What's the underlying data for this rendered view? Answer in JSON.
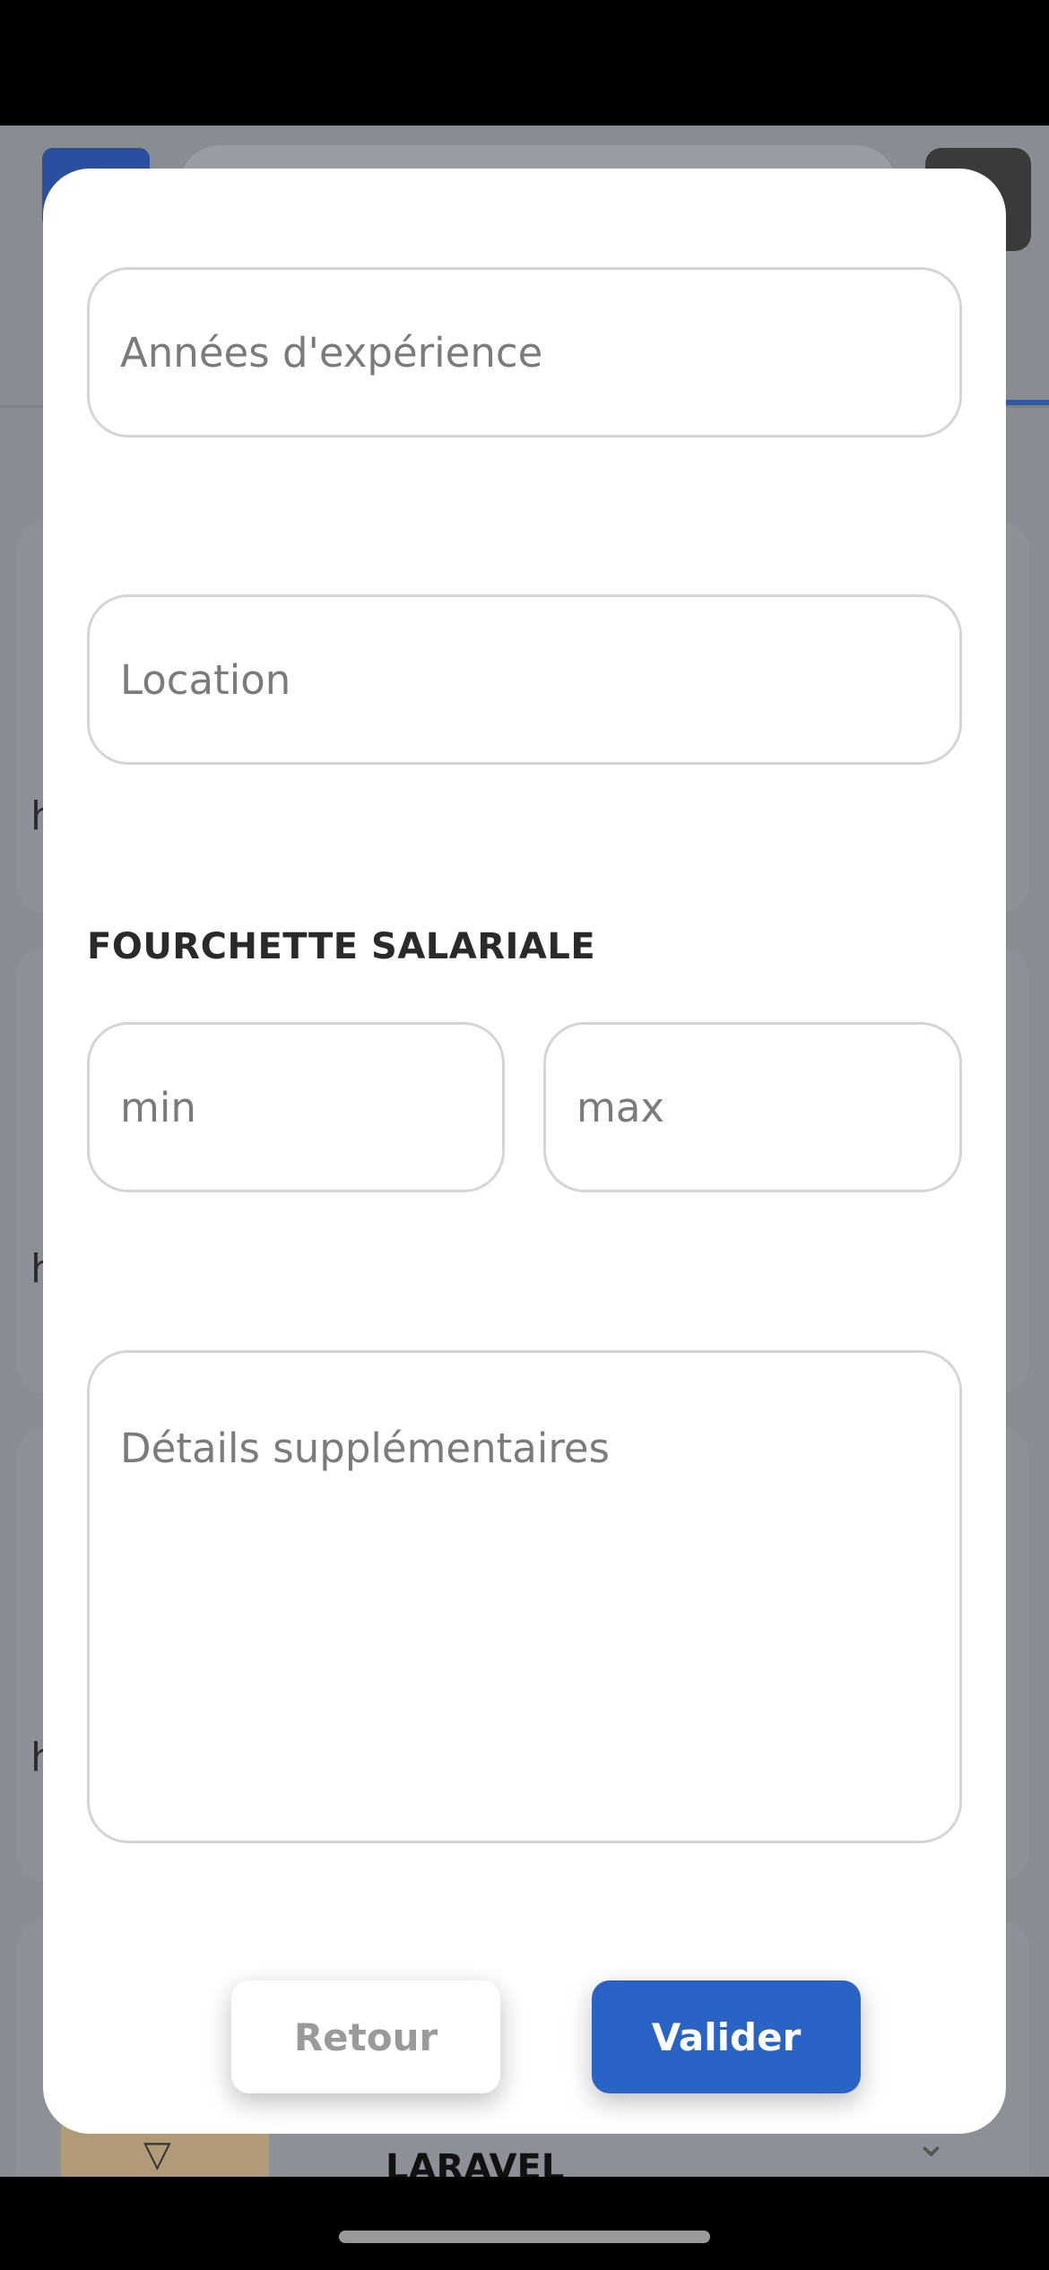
{
  "form": {
    "experience_placeholder": "Années d'expérience",
    "location_placeholder": "Location",
    "salary_section_title": "FOURCHETTE SALARIALE",
    "salary_min_placeholder": "min",
    "salary_max_placeholder": "max",
    "details_placeholder": "Détails supplémentaires"
  },
  "actions": {
    "back_label": "Retour",
    "submit_label": "Valider"
  },
  "background": {
    "visible_text": "LARAVEL"
  },
  "colors": {
    "accent": "#2a63c6",
    "field_border": "#d5d5d5",
    "placeholder": "#7b7b7b"
  }
}
